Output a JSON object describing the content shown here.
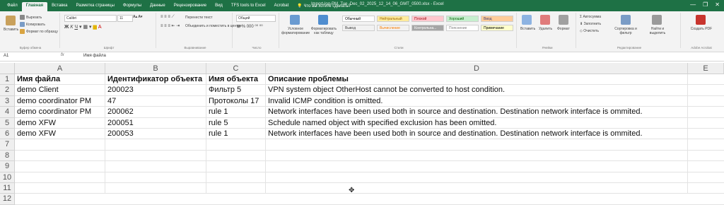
{
  "window": {
    "title": "Import-log-PM_Tue_Dec_02_2025_12_14_06_GMT_0500.xlsx - Excel",
    "controls": [
      "—",
      "❐",
      "✕"
    ]
  },
  "tabs": [
    "Файл",
    "Главная",
    "Вставка",
    "Разметка страницы",
    "Формулы",
    "Данные",
    "Рецензирование",
    "Вид",
    "TFS tools to Excel",
    "Acrobat",
    "Что вы хотите сделать?"
  ],
  "active_tab_index": 1,
  "ribbon": {
    "clipboard": {
      "paste": "Вставить",
      "cut": "Вырезать",
      "copy": "Копировать",
      "format_painter": "Формат по образцу",
      "label": "Буфер обмена"
    },
    "font": {
      "name": "Calibri",
      "size": "11",
      "label": "Шрифт"
    },
    "alignment": {
      "wrap": "Перенести текст",
      "merge": "Объединить и поместить в центре",
      "label": "Выравнивание"
    },
    "number": {
      "format": "Общий",
      "label": "Число"
    },
    "styles": {
      "conditional": "Условное форматирование",
      "as_table": "Форматировать как таблицу",
      "cells": [
        {
          "name": "Обычный",
          "bg": "#ffffff",
          "fg": "#000000"
        },
        {
          "name": "Нейтральный",
          "bg": "#ffeb9c",
          "fg": "#9c6500"
        },
        {
          "name": "Плохой",
          "bg": "#ffc7ce",
          "fg": "#9c0006"
        },
        {
          "name": "Хороший",
          "bg": "#c6efce",
          "fg": "#006100"
        },
        {
          "name": "Ввод",
          "bg": "#ffcc99",
          "fg": "#3f3f76"
        },
        {
          "name": "Вывод",
          "bg": "#f2f2f2",
          "fg": "#3f3f3f"
        },
        {
          "name": "Вычисление",
          "bg": "#f2f2f2",
          "fg": "#fa7d00"
        },
        {
          "name": "Контрольна...",
          "bg": "#a5a5a5",
          "fg": "#ffffff"
        },
        {
          "name": "Пояснение",
          "bg": "#ffffff",
          "fg": "#7f7f7f"
        },
        {
          "name": "Примечание",
          "bg": "#ffffcc",
          "fg": "#000000"
        }
      ],
      "label": "Стили"
    },
    "cells_group": {
      "insert": "Вставить",
      "delete": "Удалить",
      "format": "Формат",
      "label": "Ячейки"
    },
    "editing": {
      "autosum": "Автосумма",
      "fill": "Заполнить",
      "clear": "Очистить",
      "sort": "Сортировка и фильтр",
      "find": "Найти и выделить",
      "label": "Редактирование"
    },
    "pdf": {
      "create": "Создать PDF",
      "label": "Adobe Acrobat"
    }
  },
  "formula_bar": {
    "name_box": "A1",
    "fx": "fx",
    "content": "Имя файла"
  },
  "columns": [
    "A",
    "B",
    "C",
    "D",
    "E"
  ],
  "rows": [
    "1",
    "2",
    "3",
    "4",
    "5",
    "6",
    "7",
    "8",
    "9",
    "10",
    "11",
    "12"
  ],
  "table": {
    "headers": [
      "Имя файла",
      "Идентификатор объекта",
      "Имя объекта",
      "Описание проблемы"
    ],
    "data": [
      [
        "demo Client",
        "200023",
        "Фильтр 5",
        "VPN system object OtherHost cannot be converted to host condition."
      ],
      [
        "demo coordinator PM",
        "47",
        "Протоколы 17",
        "Invalid ICMP condition is omitted."
      ],
      [
        "demo coordinator PM",
        "200062",
        "rule 1",
        "Network interfaces have been used both in source and destination. Destination network interface is ommited."
      ],
      [
        "demo XFW",
        "200051",
        "rule 5",
        "Schedule named object with specified exclusion has been omitted."
      ],
      [
        "demo XFW",
        "200053",
        "rule 1",
        "Network interfaces have been used both in source and destination. Destination network interface is ommited."
      ]
    ]
  },
  "colors": {
    "excel_green": "#1e7145"
  }
}
